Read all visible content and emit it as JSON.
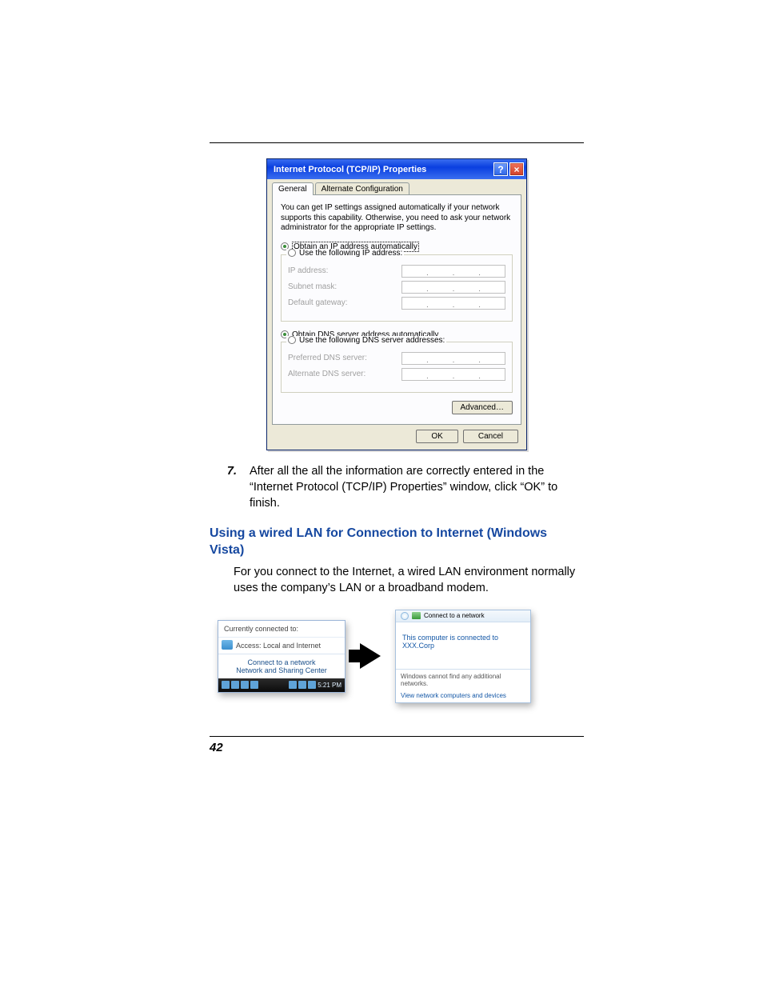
{
  "page_number": "42",
  "dialog": {
    "title": "Internet Protocol (TCP/IP) Properties",
    "tabs": {
      "general": "General",
      "altconfig": "Alternate Configuration"
    },
    "description": "You can get IP settings assigned automatically if your network supports this capability. Otherwise, you need to ask your network administrator for the appropriate IP settings.",
    "radio_ip_auto": "Obtain an IP address automatically",
    "radio_ip_manual": "Use the following IP address:",
    "fields": {
      "ip": "IP address:",
      "subnet": "Subnet mask:",
      "gateway": "Default gateway:"
    },
    "radio_dns_auto": "Obtain DNS server address automatically",
    "radio_dns_manual": "Use the following DNS server addresses:",
    "dns_fields": {
      "preferred": "Preferred DNS server:",
      "alternate": "Alternate DNS server:"
    },
    "advanced": "Advanced…",
    "ok": "OK",
    "cancel": "Cancel"
  },
  "step": {
    "num": "7.",
    "text": "After all the all the information are correctly entered in the “Internet Protocol (TCP/IP) Properties” window, click “OK” to finish."
  },
  "heading": "Using a wired LAN for Connection to Internet (Windows Vista)",
  "section_body": "For you connect to the Internet, a wired LAN environment normally uses the company’s LAN or a broadband modem.",
  "vista_popup": {
    "header": "Currently connected to:",
    "access": "Access:  Local and Internet",
    "link1": "Connect to a network",
    "link2": "Network and Sharing Center",
    "clock": "5:21 PM"
  },
  "vista_dialog": {
    "title": "Connect to a network",
    "msg": "This computer is connected to XXX.Corp",
    "section": "Windows cannot find any additional networks.",
    "link": "View network computers and devices"
  }
}
